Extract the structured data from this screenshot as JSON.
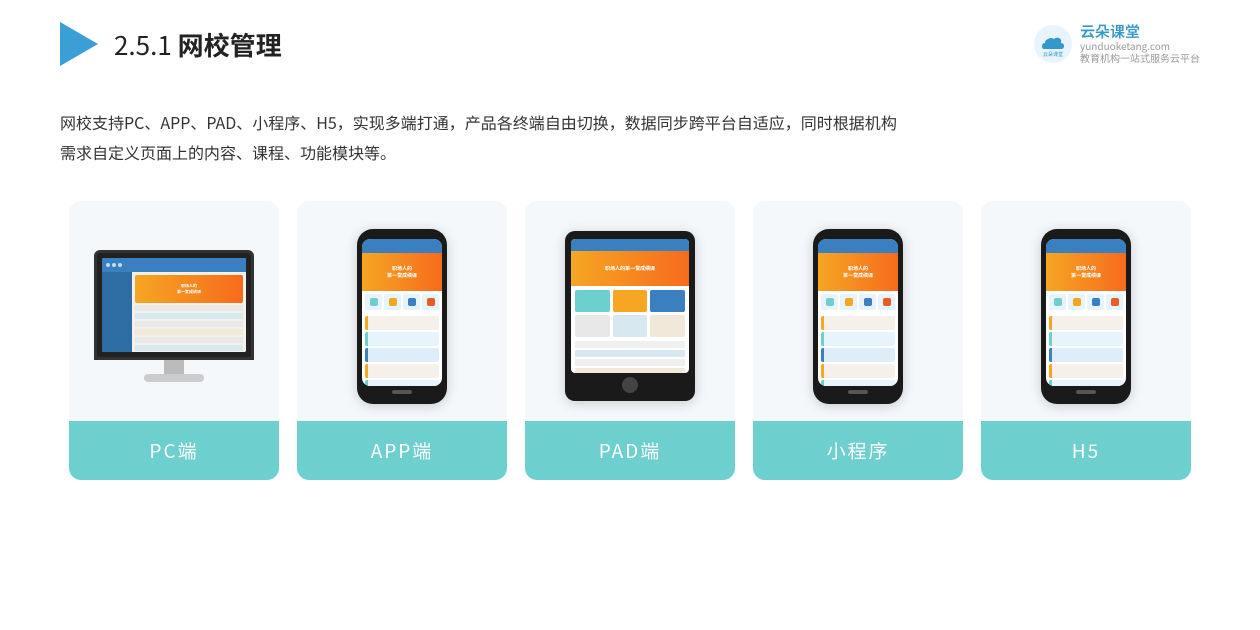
{
  "header": {
    "title_prefix": "2.5.1 ",
    "title_main": "网校管理",
    "brand": {
      "name": "云朵课堂",
      "domain": "yunduoketang.com",
      "tagline_line1": "教育机构一站",
      "tagline_line2": "式服务云平台"
    }
  },
  "description": {
    "line1": "网校支持PC、APP、PAD、小程序、H5，实现多端打通，产品各终端自由切换，数据同步跨平台自适应，同时根据机构",
    "line2": "需求自定义页面上的内容、课程、功能模块等。"
  },
  "cards": [
    {
      "id": "pc",
      "label": "PC端"
    },
    {
      "id": "app",
      "label": "APP端"
    },
    {
      "id": "pad",
      "label": "PAD端"
    },
    {
      "id": "mini",
      "label": "小程序"
    },
    {
      "id": "h5",
      "label": "H5"
    }
  ],
  "colors": {
    "accent": "#6ecfcf",
    "blue": "#3a7fbf",
    "orange": "#f5a623",
    "triangle": "#3b9ed4"
  }
}
